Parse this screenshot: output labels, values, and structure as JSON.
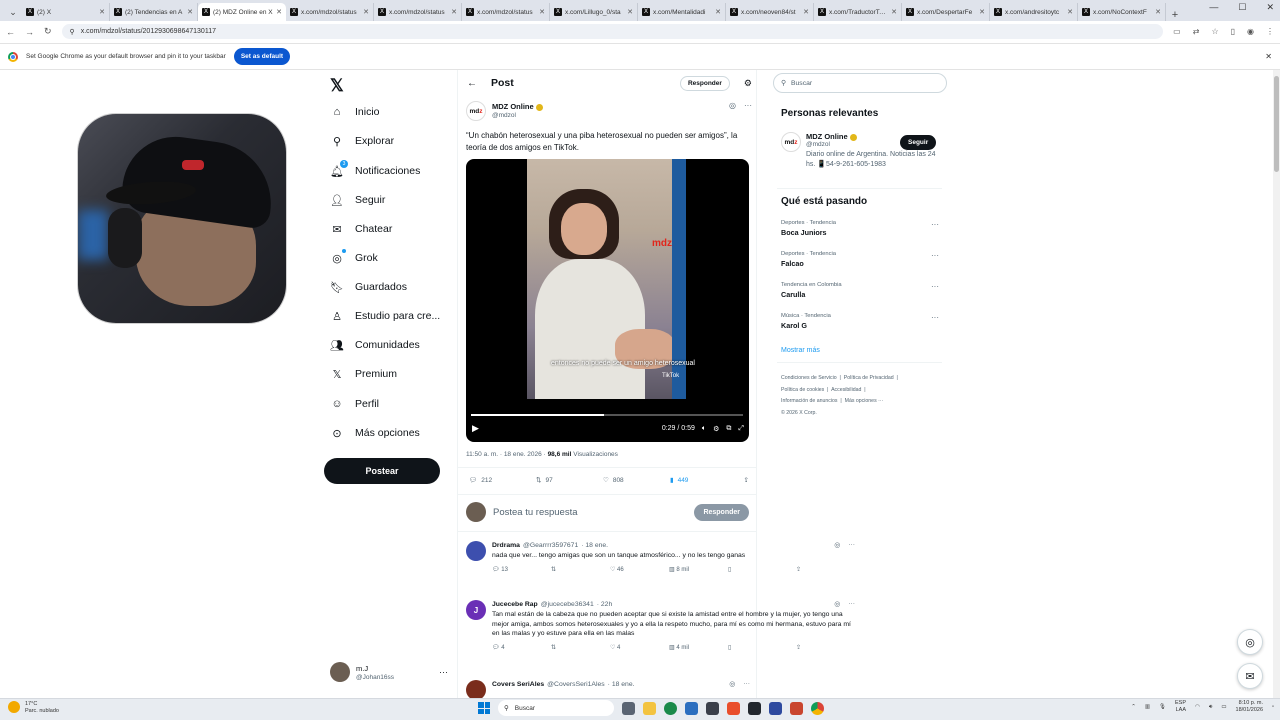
{
  "browser": {
    "tabs": [
      {
        "title": "(2) X",
        "active": false
      },
      {
        "title": "(2) Tendencias en A",
        "active": false
      },
      {
        "title": "(2) MDZ Online en X",
        "active": true
      },
      {
        "title": "x.com/mdzol/status",
        "active": false
      },
      {
        "title": "x.com/mdzol/status",
        "active": false
      },
      {
        "title": "x.com/mdzol/status",
        "active": false
      },
      {
        "title": "x.com/Lillugo_0/sta",
        "active": false
      },
      {
        "title": "x.com/Mentalidadi",
        "active": false
      },
      {
        "title": "x.com/neoven84/st",
        "active": false
      },
      {
        "title": "x.com/TraductorTeAl",
        "active": false
      },
      {
        "title": "x.com/DespertarFe",
        "active": false
      },
      {
        "title": "x.com/andresitoytc",
        "active": false
      },
      {
        "title": "x.com/NoContextF",
        "active": false
      }
    ],
    "url": "x.com/mdzol/status/2012930698647130117",
    "infobar_text": "Set Google Chrome as your default browser and pin it to your taskbar",
    "infobar_button": "Set as default"
  },
  "nav": {
    "items": [
      {
        "label": "Inicio",
        "icon": "home-icon"
      },
      {
        "label": "Explorar",
        "icon": "search-icon"
      },
      {
        "label": "Notificaciones",
        "icon": "bell-icon",
        "badge": "3"
      },
      {
        "label": "Seguir",
        "icon": "follow-icon"
      },
      {
        "label": "Chatear",
        "icon": "mail-icon"
      },
      {
        "label": "Grok",
        "icon": "grok-icon"
      },
      {
        "label": "Guardados",
        "icon": "bookmark-icon"
      },
      {
        "label": "Estudio para cre...",
        "icon": "studio-icon"
      },
      {
        "label": "Comunidades",
        "icon": "communities-icon"
      },
      {
        "label": "Premium",
        "icon": "x-icon"
      },
      {
        "label": "Perfil",
        "icon": "profile-icon"
      },
      {
        "label": "Más opciones",
        "icon": "more-icon"
      }
    ],
    "post_button": "Postear",
    "user": {
      "name": "m.J",
      "handle": "@Johan16ss"
    }
  },
  "post": {
    "header_title": "Post",
    "reply_button": "Responder",
    "author_name": "MDZ Online",
    "author_handle": "@mdzol",
    "text": "“Un chabón heterosexual y una piba heterosexual no pueden ser amigos”, la teoría de dos amigos en TikTok.",
    "video": {
      "watermark_a": "md",
      "watermark_b": "z",
      "subtitle": "entonces no puede ser un amigo heterosexual",
      "tiktok": "TikTok",
      "time": "0:29 / 0:59",
      "progress": 0.49
    },
    "meta_time": "11:50 a. m. · 18 ene. 2026 ·",
    "views": "98,6 mil",
    "views_label": "Visualizaciones",
    "stats": {
      "replies": "212",
      "reposts": "97",
      "likes": "808",
      "bookmarks": "449"
    },
    "reply_placeholder": "Postea tu respuesta",
    "reply_submit": "Responder"
  },
  "replies": [
    {
      "name": "Drdrama",
      "handle": "@Gearrrr3597671",
      "time": "· 18 ene.",
      "text": "nada que ver... tengo amigas que son un tanque atmosférico... y no les tengo ganas",
      "replies": "13",
      "reposts": "",
      "likes": "46",
      "views": "8 mil",
      "avatar_color": "#3d4fae"
    },
    {
      "name": "Jucecebe Rap",
      "handle": "@jucecebe36341",
      "time": "· 22h",
      "text": "Tan mal están de la cabeza que no pueden aceptar que si existe la amistad entre el hombre y la mujer, yo tengo una mejor amiga, ambos somos heterosexuales y yo a ella la respeto mucho, para mí es como mi hermana, estuvo para mí en las malas y yo estuve para ella en las malas",
      "replies": "4",
      "reposts": "",
      "likes": "4",
      "views": "4 mil",
      "avatar_letter": "J",
      "avatar_color": "#6a2fb6"
    },
    {
      "name": "Covers SeriAles",
      "handle": "@CoversSeri1Ales",
      "time": "· 18 ene.",
      "text": "",
      "replies": "",
      "reposts": "",
      "likes": "",
      "views": "",
      "avatar_color": "#7a2d1c"
    }
  ],
  "right": {
    "search_placeholder": "Buscar",
    "relevant_title": "Personas relevantes",
    "relevant": {
      "name": "MDZ Online",
      "handle": "@mdzol",
      "bio": "Diario online de Argentina. Noticias las 24 hs. 📱54-9-261-605-1983",
      "follow": "Seguir"
    },
    "trends_title": "Qué está pasando",
    "trends": [
      {
        "category": "Deportes · Tendencia",
        "name": "Boca Juniors"
      },
      {
        "category": "Deportes · Tendencia",
        "name": "Falcao"
      },
      {
        "category": "Tendencia en Colombia",
        "name": "Carulla"
      },
      {
        "category": "Música · Tendencia",
        "name": "Karol G"
      }
    ],
    "show_more": "Mostrar más",
    "footer": {
      "terms": "Condiciones de Servicio",
      "privacy": "Política de Privacidad",
      "cookies": "Política de cookies",
      "access": "Accesibilidad",
      "ads": "Información de anuncios",
      "more": "Más opciones ···",
      "copyright": "© 2026 X Corp."
    }
  },
  "taskbar": {
    "temp": "17°C",
    "weather": "Parc. nublado",
    "search": "Buscar",
    "lang_a": "ESP",
    "lang_b": "LAA",
    "time": "8:10 p. m.",
    "date": "18/01/2026"
  }
}
